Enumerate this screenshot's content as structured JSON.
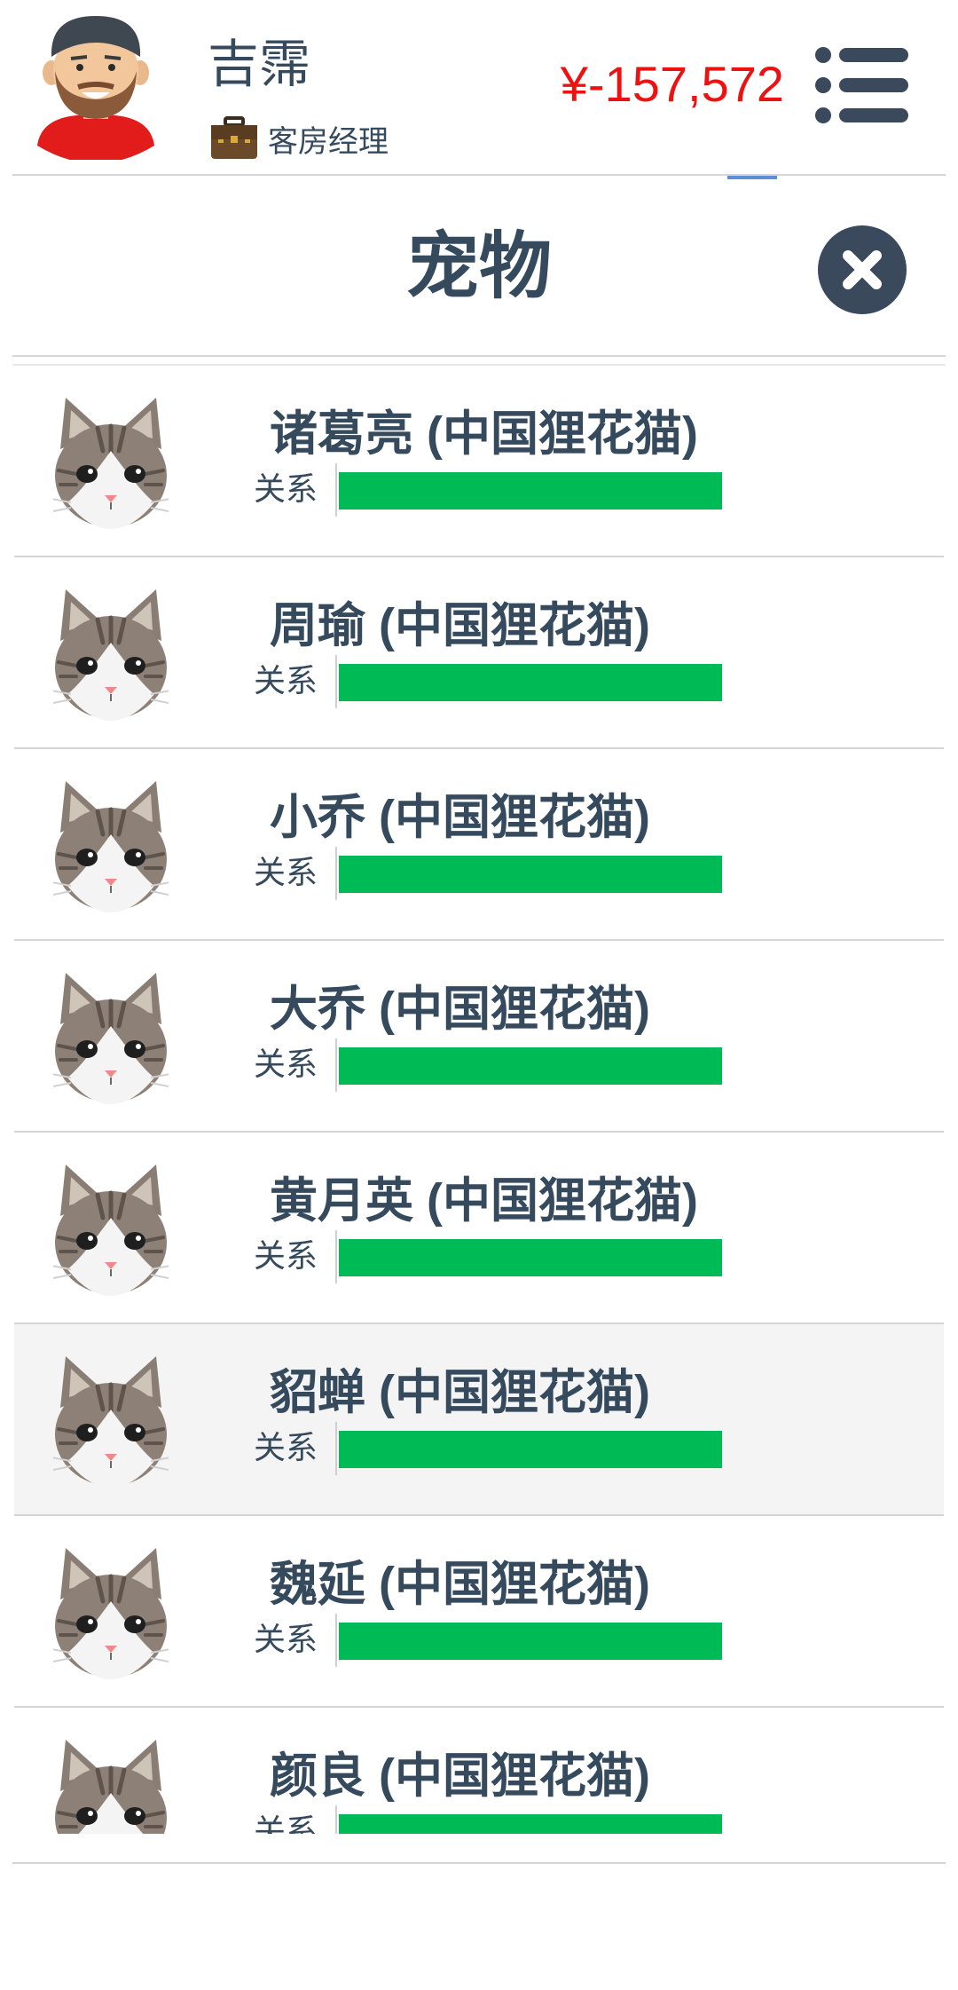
{
  "header": {
    "user_name": "吉霈",
    "job_title": "客房经理",
    "balance": "¥-157,572",
    "balance_color": "#ee1111",
    "avatar_icon": "bearded-man-avatar-icon",
    "job_icon": "briefcase-icon",
    "menu_icon": "menu-list-icon"
  },
  "modal": {
    "title": "宠物",
    "close_icon": "close-x-icon"
  },
  "pets": {
    "relation_label": "关系",
    "relation_color": "#00bb55",
    "items": [
      {
        "name": "诸葛亮 (中国狸花猫)",
        "relation": 1.0,
        "highlighted": false
      },
      {
        "name": "周瑜 (中国狸花猫)",
        "relation": 1.0,
        "highlighted": false
      },
      {
        "name": "小乔 (中国狸花猫)",
        "relation": 1.0,
        "highlighted": false
      },
      {
        "name": "大乔 (中国狸花猫)",
        "relation": 1.0,
        "highlighted": false
      },
      {
        "name": "黄月英 (中国狸花猫)",
        "relation": 1.0,
        "highlighted": false
      },
      {
        "name": "貂蝉 (中国狸花猫)",
        "relation": 1.0,
        "highlighted": true
      },
      {
        "name": "魏延 (中国狸花猫)",
        "relation": 1.0,
        "highlighted": false
      },
      {
        "name": "颜良 (中国狸花猫)",
        "relation": 1.0,
        "highlighted": false
      }
    ]
  }
}
